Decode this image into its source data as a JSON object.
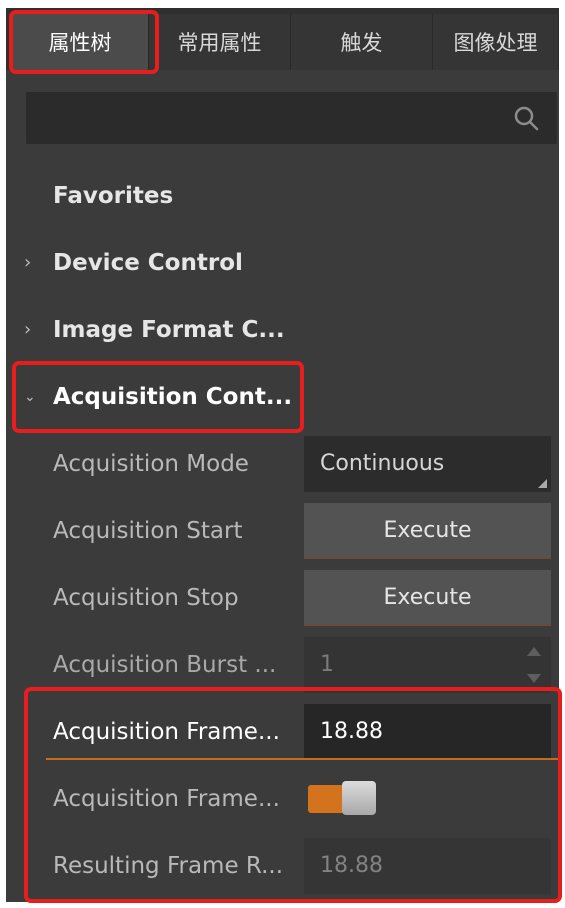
{
  "tabs": [
    {
      "label": "属性树"
    },
    {
      "label": "常用属性"
    },
    {
      "label": "触发"
    },
    {
      "label": "图像处理"
    }
  ],
  "search": {
    "placeholder": "",
    "icon": "search-icon"
  },
  "tree": {
    "favorites": "Favorites",
    "device_control": "Device Control",
    "image_format": "Image Format C...",
    "acquisition": "Acquisition Cont...",
    "props": {
      "mode": {
        "label": "Acquisition Mode",
        "value": "Continuous"
      },
      "start": {
        "label": "Acquisition Start",
        "value": "Execute"
      },
      "stop": {
        "label": "Acquisition Stop",
        "value": "Execute"
      },
      "burst": {
        "label": "Acquisition Burst ...",
        "value": "1"
      },
      "frame_rate": {
        "label": "Acquisition Frame...",
        "value": "18.88"
      },
      "frame_rate_enable": {
        "label": "Acquisition Frame...",
        "state": "on"
      },
      "resulting": {
        "label": "Resulting Frame R...",
        "value": "18.88"
      }
    }
  },
  "colors": {
    "panel": "#3b3b3b",
    "accent": "#d4731e",
    "highlight": "#e81d1d"
  }
}
